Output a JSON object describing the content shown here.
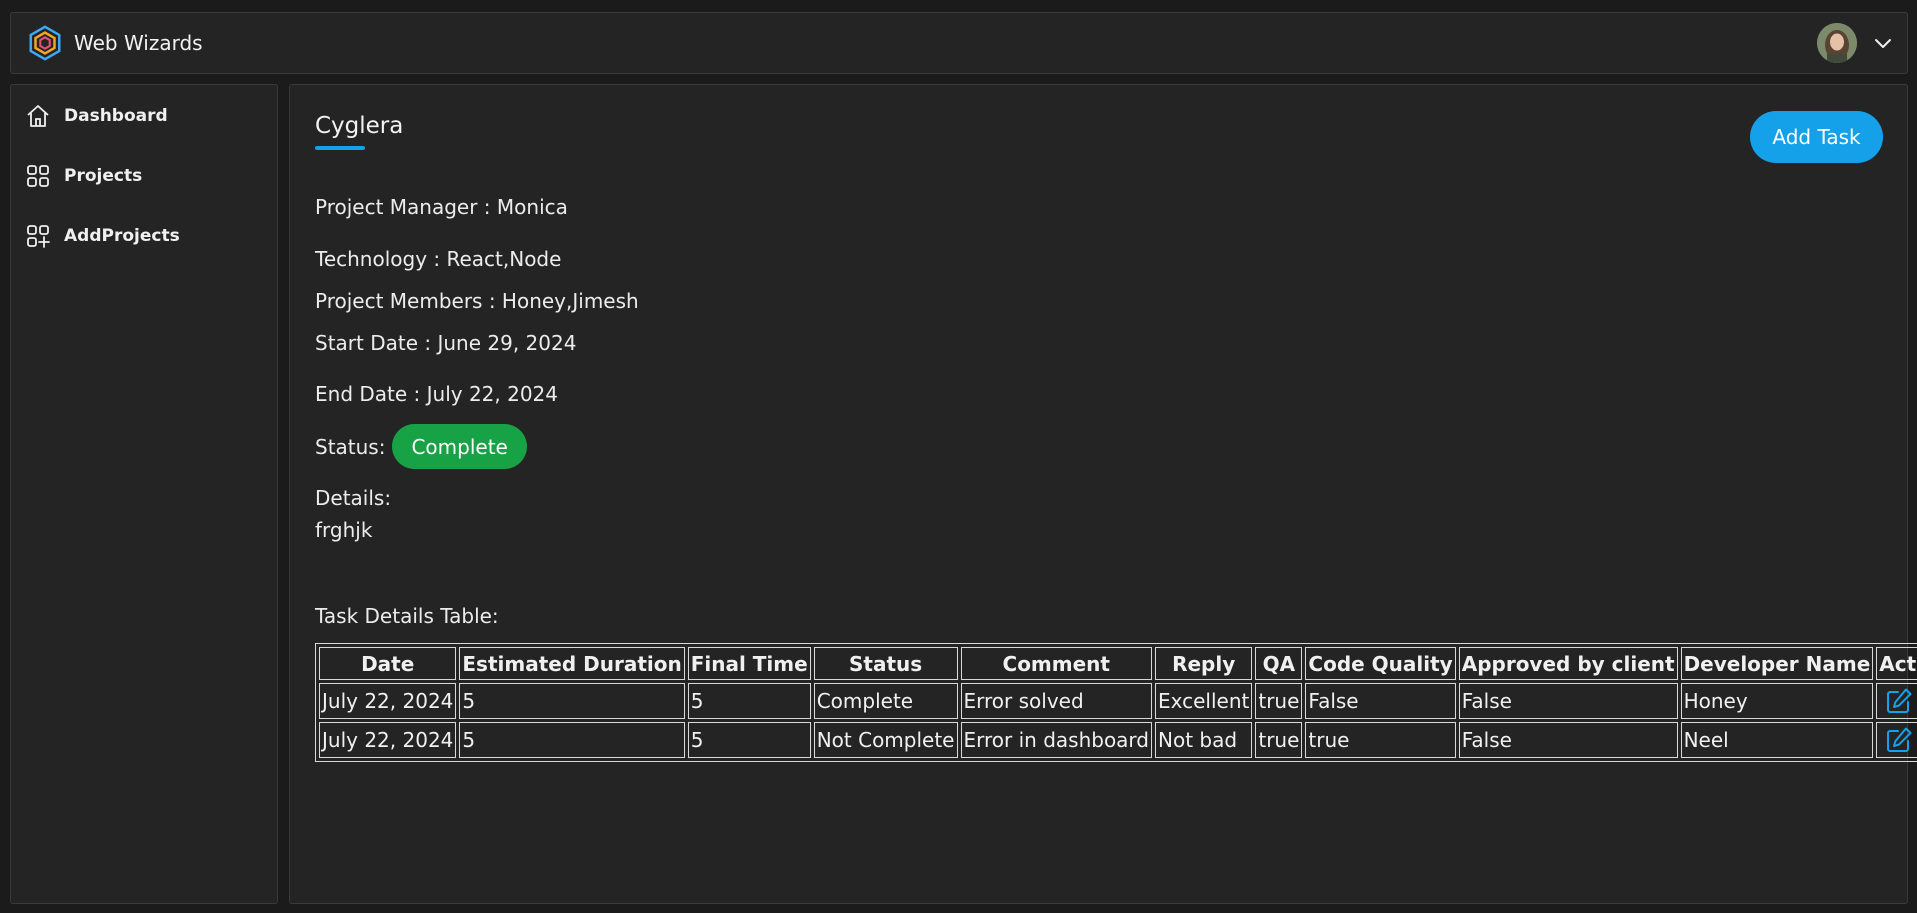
{
  "app": {
    "name": "Web Wizards"
  },
  "sidebar": {
    "items": [
      {
        "label": "Dashboard",
        "icon": "home-icon"
      },
      {
        "label": "Projects",
        "icon": "grid-icon"
      },
      {
        "label": "AddProjects",
        "icon": "grid-add-icon"
      }
    ]
  },
  "project": {
    "name": "Cyglera",
    "add_task_label": "Add Task",
    "manager": "Project Manager : Monica",
    "technology": "Technology : React,Node",
    "members": "Project Members : Honey,Jimesh",
    "start_date": "Start Date : June 29, 2024",
    "end_date": "End Date : July 22, 2024",
    "status_label": "Status:",
    "status_value": "Complete",
    "details_label": "Details:",
    "details_value": "frghjk"
  },
  "table": {
    "caption": "Task Details Table:",
    "headers": [
      "Date",
      "Estimated Duration",
      "Final Time",
      "Status",
      "Comment",
      "Reply",
      "QA",
      "Code Quality",
      "Approved by client",
      "Developer Name",
      "Actions"
    ],
    "rows": [
      [
        "July 22, 2024",
        "5",
        "5",
        "Complete",
        "Error solved",
        "Excellent",
        "true",
        "False",
        "False",
        "Honey"
      ],
      [
        "July 22, 2024",
        "5",
        "5",
        "Not Complete",
        "Error in dashboard",
        "Not bad",
        "true",
        "true",
        "False",
        "Neel"
      ]
    ]
  },
  "colors": {
    "accent": "#14a1ea",
    "status_complete": "#17a245",
    "delete": "#e5484d",
    "background": "#1b1b1b",
    "panel": "#242424"
  }
}
